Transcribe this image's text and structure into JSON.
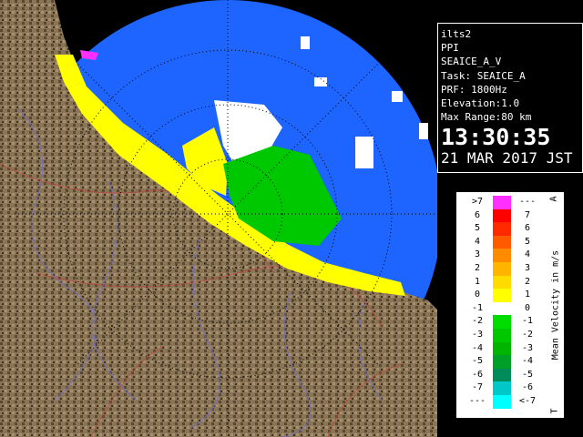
{
  "radar": {
    "site": "ilts2",
    "scan_mode": "PPI",
    "product": "SEAICE_A_V",
    "task": "Task: SEAICE_A",
    "prf": "PRF: 1800Hz",
    "elevation": "Elevation:1.0",
    "max_range": "Max Range:80 km",
    "time": "13:30:35",
    "date": "21 MAR 2017 JST"
  },
  "legend": {
    "unit_label": "Mean Velocity in m/s",
    "top_marker": "A",
    "bottom_marker": "T",
    "rows": [
      {
        "left": ">7",
        "right": "---",
        "color": "#ff30ff"
      },
      {
        "left": "6",
        "right": "7",
        "color": "#ff0000"
      },
      {
        "left": "5",
        "right": "6",
        "color": "#ff2a00"
      },
      {
        "left": "4",
        "right": "5",
        "color": "#ff5a00"
      },
      {
        "left": "3",
        "right": "4",
        "color": "#ff8c00"
      },
      {
        "left": "2",
        "right": "3",
        "color": "#ffb400"
      },
      {
        "left": "1",
        "right": "2",
        "color": "#ffdc00"
      },
      {
        "left": "0",
        "right": "1",
        "color": "#ffff00"
      },
      {
        "left": "-1",
        "right": "0",
        "color": "#ffffff"
      },
      {
        "left": "-2",
        "right": "-1",
        "color": "#00dc00"
      },
      {
        "left": "-3",
        "right": "-2",
        "color": "#00c800"
      },
      {
        "left": "-4",
        "right": "-3",
        "color": "#00b400"
      },
      {
        "left": "-5",
        "right": "-4",
        "color": "#00a028"
      },
      {
        "left": "-6",
        "right": "-5",
        "color": "#008c5a"
      },
      {
        "left": "-7",
        "right": "-6",
        "color": "#00c8c8"
      },
      {
        "left": "---",
        "right": "<-7",
        "color": "#00ffff"
      }
    ]
  },
  "colors": {
    "sea": "#1e64ff",
    "land": "#8a7556",
    "land_dark": "#5c4a30",
    "coast_echo": "#ffff00",
    "approaching": "#00c800",
    "zero": "#ffffff",
    "receding_strong": "#ff30ff"
  }
}
